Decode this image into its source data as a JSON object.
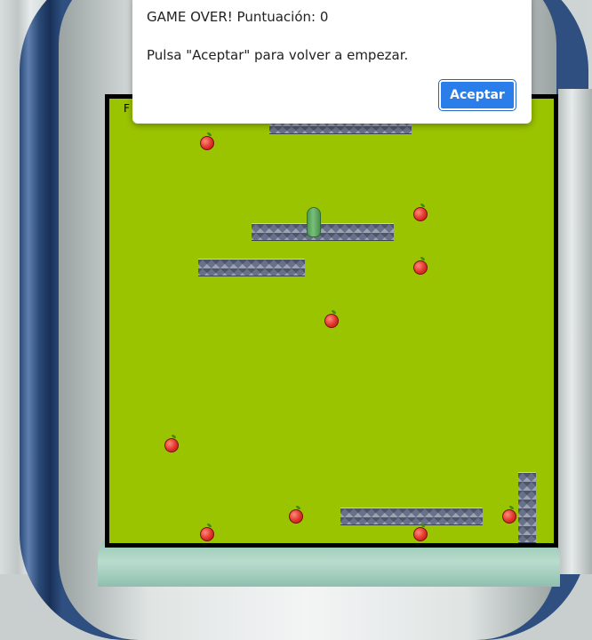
{
  "dialog": {
    "title": "GAME OVER! Puntuación: 0",
    "message": "Pulsa \"Aceptar\" para volver a empezar.",
    "accept_label": "Aceptar"
  },
  "board": {
    "score_label": "F"
  },
  "colors": {
    "board": "#9bc400",
    "border": "#000000",
    "wall": "#68718a",
    "apple": "#e0322b",
    "snake": "#5fa863",
    "button": "#2b7de9"
  },
  "icons": [
    "apple-icon",
    "snake-head",
    "wall-block"
  ]
}
